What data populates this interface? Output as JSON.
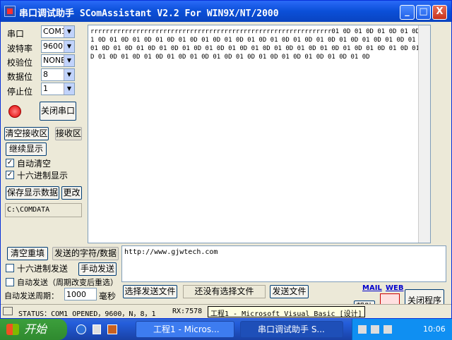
{
  "window": {
    "title": "串口调试助手  SComAssistant V2.2 For WIN9X/NT/2000",
    "min": "_",
    "max": "□",
    "close": "X"
  },
  "serial": {
    "port_label": "串口",
    "port_value": "COM1",
    "baud_label": "波特率",
    "baud_value": "9600",
    "parity_label": "校验位",
    "parity_value": "NONE",
    "data_label": "数据位",
    "data_value": "8",
    "stop_label": "停止位",
    "stop_value": "1",
    "close_port": "关闭串口"
  },
  "receive": {
    "clear": "清空接收区",
    "area": "接收区",
    "continue": "继续显示",
    "auto_clear": "自动清空",
    "hex_display": "十六进制显示",
    "save_data": "保存显示数据",
    "change": "更改",
    "path": "C:\\COMDATA",
    "content": "rrrrrrrrrrrrrrrrrrrrrrrrrrrrrrrrrrrrrrrrrrrrrrrrrrrrrrrrrrrrrrr01 0D 01 0D 01 0D 01 0D 01 0D 01 0D 01 0D 01 0D 01 0D 01 0D 01 0D 01 0D 01 0D 01 0D 01 0D 01 0D 01 0D 01 0D 01 0D 01 0D 01 0D 01 0D 01 0D 01 0D 01 0D 01 0D 01 0D 01 0D 01 0D 01 0D 01 0D 01 0D 01 0D 01 0D 01 0D 01 0D 01 0D 01 0D 01 0D 01 0D 01 0D 01 0D 01 0D 01 0D 01 0D 01 0D"
  },
  "send": {
    "clear_resend": "清空重填",
    "sent_chars": "发送的字符/数据",
    "hex_send": "十六进制发送",
    "manual_send": "手动发送",
    "auto_send": "自动发送（周期改变后重选）",
    "period_label": "自动发送周期：",
    "period_value": "1000",
    "period_unit": "毫秒",
    "text": "http://www.gjwtech.com",
    "choose_file": "选择发送文件",
    "no_file": "还没有选择文件",
    "send_file": "发送文件",
    "mail": "MAIL",
    "web": "WEB",
    "help": "帮助",
    "close_program": "关闭程序"
  },
  "status": {
    "text": "STATUS：COM1 OPENED，9600，N，8，1",
    "rx": "RX:7578",
    "tooltip": "工程1 - Microsoft Visual Basic [设计]"
  },
  "taskbar": {
    "start": "开始",
    "task1": "工程1 - Micros...",
    "task2": "串口调试助手 S...",
    "clock": "10:06"
  }
}
